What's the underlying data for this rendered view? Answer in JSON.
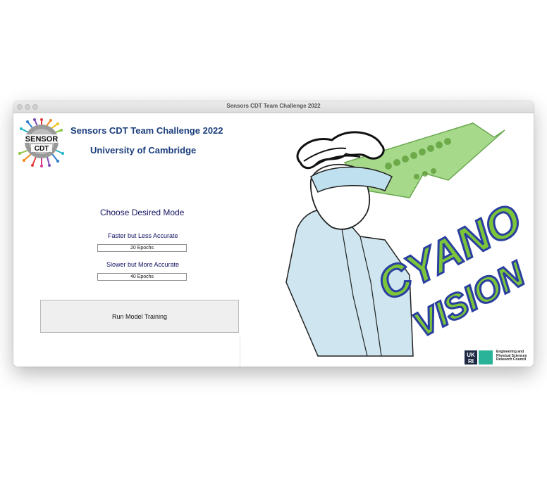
{
  "window": {
    "title": "Sensors CDT Team Challenge 2022"
  },
  "header": {
    "title": "Sensors CDT Team Challenge 2022",
    "subtitle": "University of Cambridge",
    "logo_text_top": "SENSOR",
    "logo_text_bottom": "CDT"
  },
  "mode": {
    "heading": "Choose Desired Mode",
    "options": [
      {
        "label": "Faster but Less Accurate",
        "button": "20 Epochs"
      },
      {
        "label": "Slower but More Accurate",
        "button": "40 Epochs"
      }
    ]
  },
  "actions": {
    "run_label": "Run Model Training"
  },
  "art": {
    "logo_line1": "CYANO",
    "logo_line2": "VISION"
  },
  "funder": {
    "mark_top": "UK",
    "mark_bottom": "RI",
    "line1": "Engineering and",
    "line2": "Physical Sciences",
    "line3": "Research Council"
  },
  "colors": {
    "title_blue": "#1a3d7c",
    "heading_navy": "#101060",
    "cyano_green": "#7cc53a",
    "cyano_outline": "#2a3fa0",
    "coat_blue": "#cfe6f0",
    "ukri_teal": "#2bb39a"
  }
}
